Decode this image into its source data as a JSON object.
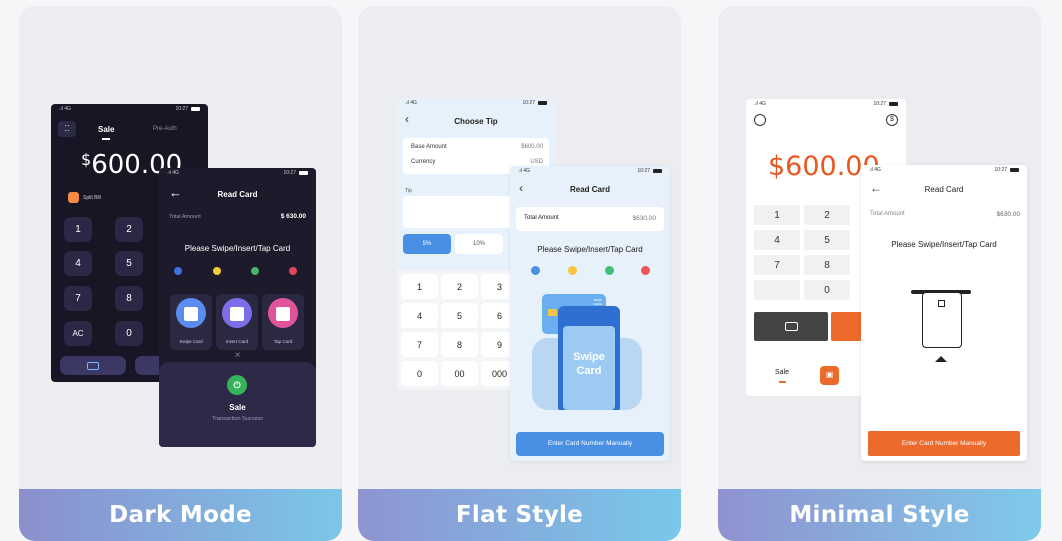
{
  "status": {
    "signal": ".ıl 4G",
    "time": "10:27"
  },
  "dark": {
    "caption": "Dark Mode",
    "sale_tab": "Sale",
    "preauth_tab": "Pre-Auth",
    "currency_symbol": "$",
    "amount": "600.00",
    "split_bill": "Split Bill",
    "keys": [
      "1",
      "2",
      "4",
      "5",
      "7",
      "8",
      "AC",
      "0"
    ],
    "read_card": {
      "title": "Read Card",
      "total_label": "Total Amount",
      "total_value": "$ 630.00",
      "prompt": "Please Swipe/Insert/Tap Card",
      "options": [
        "Swipe Card",
        "Insert Card",
        "Tap Card"
      ],
      "close": "×",
      "result_title": "Sale",
      "result_sub": "Transaction Success"
    }
  },
  "flat": {
    "caption": "Flat Style",
    "tip": {
      "title": "Choose Tip",
      "base_label": "Base Amount",
      "base_value": "$600.00",
      "currency_label": "Currency",
      "currency_value": "USD",
      "tip_label": "Tip",
      "options": [
        "5%",
        "10%"
      ],
      "keys": [
        "1",
        "2",
        "3",
        "4",
        "5",
        "6",
        "7",
        "8",
        "9",
        "0",
        "00",
        "000"
      ]
    },
    "read_card": {
      "title": "Read Card",
      "total_label": "Total Amount",
      "total_value": "$630.00",
      "prompt": "Please Swipe/Insert/Tap Card",
      "card_bank": "BANK NAME",
      "terminal_text": "Swipe Card",
      "manual_button": "Enter Card Number Manually"
    }
  },
  "minimal": {
    "caption": "Minimal Style",
    "amount": "$600.00",
    "keys": [
      "1",
      "2",
      "4",
      "5",
      "7",
      "8",
      "0"
    ],
    "sale_tab": "Sale",
    "read_card": {
      "title": "Read Card",
      "total_label": "Total Amount",
      "total_value": "$630.00",
      "prompt": "Please Swipe/Insert/Tap Card",
      "manual_button": "Enter Card Number Manually"
    }
  },
  "colors": {
    "dark_bg": "#1a1726",
    "flat_blue": "#4a90e2",
    "minimal_orange": "#ec6a2c",
    "minimal_amount": "#e8571d"
  }
}
